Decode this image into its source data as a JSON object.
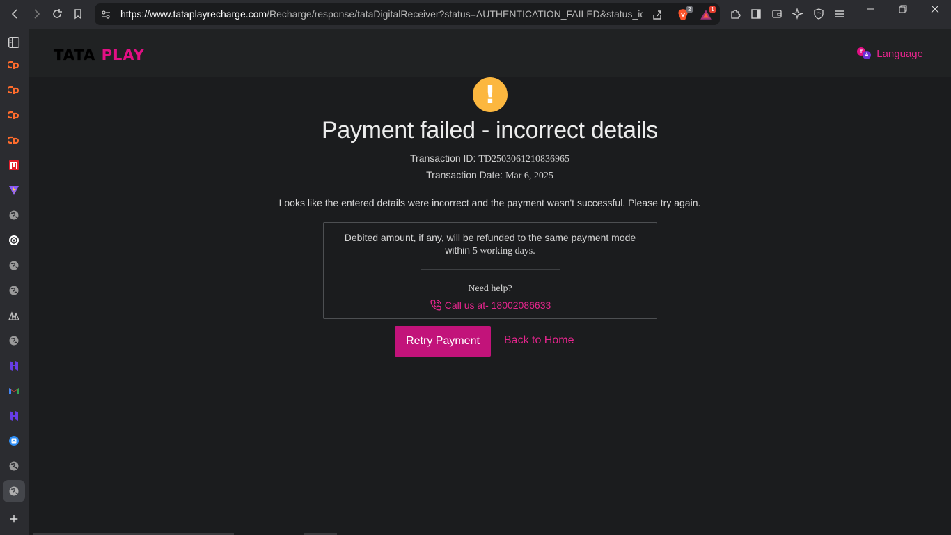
{
  "browser": {
    "url_host": "https://www.tataplayrecharge.com",
    "url_path": "/Recharge/response/tataDigitalReceiver?status=AUTHENTICATION_FAILED&status_id...",
    "brave_badge": "2",
    "rewards_badge": "1"
  },
  "header": {
    "logo_part1": "TATA",
    "logo_part2": "PLAY",
    "language_label": "Language"
  },
  "result": {
    "title": "Payment failed - incorrect details",
    "transaction_id_label": "Transaction ID:",
    "transaction_id": "TD2503061210836965",
    "transaction_date_label": "Transaction Date:",
    "transaction_date": "Mar 6, 2025",
    "message": "Looks like the entered details were incorrect and the payment wasn't successful. Please try again."
  },
  "infobox": {
    "refund_text_1": "Debited amount, if any, will be refunded to the same payment mode within",
    "refund_days": "5 working days.",
    "need_help": "Need help?",
    "call_label": "Call us at- 18002086633"
  },
  "actions": {
    "retry_label": "Retry Payment",
    "home_label": "Back to Home"
  },
  "colors": {
    "brand": "#e20f84",
    "button": "#c2137a",
    "warning": "#fcb73f"
  }
}
